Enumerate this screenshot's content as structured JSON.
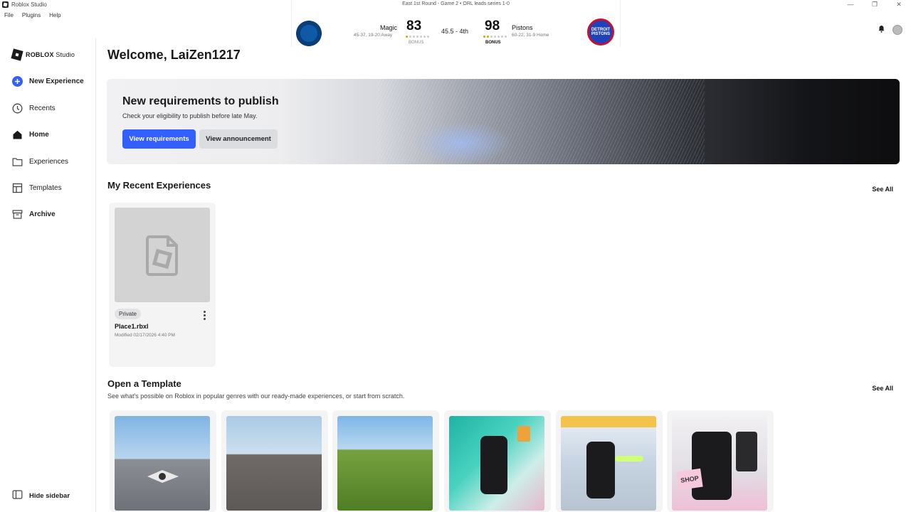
{
  "window": {
    "title": "Roblox Studio",
    "controls": [
      "—",
      "❐",
      "✕"
    ]
  },
  "menu": [
    "File",
    "Plugins",
    "Help"
  ],
  "sidebar": {
    "logo_brand": "ROBLOX",
    "logo_product": "Studio",
    "items": [
      {
        "label": "New Experience",
        "icon": "plus-circle-icon"
      },
      {
        "label": "Recents",
        "icon": "clock-icon"
      },
      {
        "label": "Home",
        "icon": "home-icon"
      },
      {
        "label": "Experiences",
        "icon": "folder-icon"
      },
      {
        "label": "Templates",
        "icon": "template-icon"
      },
      {
        "label": "Archive",
        "icon": "archive-icon"
      }
    ],
    "hide_label": "Hide sidebar"
  },
  "scoreboard": {
    "header": "East 1st Round - Game 2 • ORL leads series 1-0",
    "away": {
      "name": "Magic",
      "record": "45-37, 19-20 Away",
      "score": "83",
      "bonus": "BONUS"
    },
    "home": {
      "name": "Pistons",
      "record": "60-22, 31-9 Home",
      "score": "98",
      "bonus": "BONUS",
      "logo_text": "DETROIT PISTONS"
    },
    "period": "45.5 - 4th"
  },
  "welcome": "Welcome, LaiZen1217",
  "banner": {
    "title": "New requirements to publish",
    "text": "Check your eligibility to publish before late May.",
    "primary": "View requirements",
    "secondary": "View announcement",
    "accent": "#335fff"
  },
  "recent": {
    "title": "My Recent Experiences",
    "see_all": "See All",
    "items": [
      {
        "badge": "Private",
        "name": "Place1.rbxl",
        "modified": "Modified 02/17/2026 4:40 PM"
      }
    ]
  },
  "templates": {
    "title": "Open a Template",
    "subtitle": "See what's possible on Roblox in popular genres with our ready-made experiences, or start from scratch.",
    "see_all": "See All",
    "shop_sign": "SHOP"
  }
}
